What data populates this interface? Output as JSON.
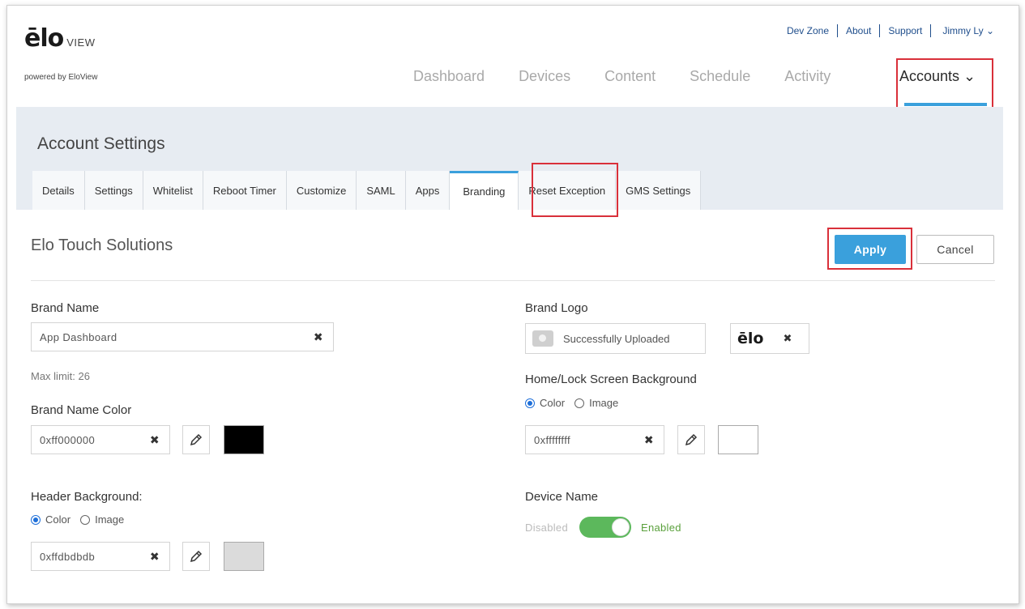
{
  "brand": {
    "logo_mark": "ēlo",
    "logo_word": "VIEW",
    "powered_by": "powered by EloView"
  },
  "util_nav": {
    "dev_zone": "Dev Zone",
    "about": "About",
    "support": "Support",
    "user": "Jimmy Ly ⌄"
  },
  "main_nav": {
    "items": [
      "Dashboard",
      "Devices",
      "Content",
      "Schedule",
      "Activity"
    ],
    "active": "Accounts ⌄"
  },
  "section_title": "Account Settings",
  "tabs": [
    "Details",
    "Settings",
    "Whitelist",
    "Reboot Timer",
    "Customize",
    "SAML",
    "Apps",
    "Branding",
    "Reset Exception",
    "GMS Settings"
  ],
  "active_tab": "Branding",
  "company": "Elo Touch Solutions",
  "actions": {
    "apply": "Apply",
    "cancel": "Cancel"
  },
  "brand_name": {
    "label": "Brand Name",
    "value": "App Dashboard",
    "hint": "Max limit: 26"
  },
  "brand_name_color": {
    "label": "Brand Name Color",
    "value": "0xff000000",
    "swatch": "#000000"
  },
  "header_background": {
    "label": "Header Background:",
    "opt_color": "Color",
    "opt_image": "Image",
    "selected": "Color",
    "value": "0xffdbdbdb",
    "swatch": "#dbdbdb"
  },
  "brand_logo": {
    "label": "Brand Logo",
    "status": "Successfully Uploaded",
    "preview": "ēlo"
  },
  "home_lock_bg": {
    "label": "Home/Lock Screen Background",
    "opt_color": "Color",
    "opt_image": "Image",
    "selected": "Color",
    "value": "0xffffffff",
    "swatch": "#ffffff"
  },
  "device_name": {
    "label": "Device Name",
    "off_label": "Disabled",
    "on_label": "Enabled",
    "enabled": true
  },
  "colors": {
    "accent": "#3aa0dc",
    "toggle_on": "#5cb85c",
    "highlight": "#d9303a",
    "band": "#e7ecf2"
  }
}
